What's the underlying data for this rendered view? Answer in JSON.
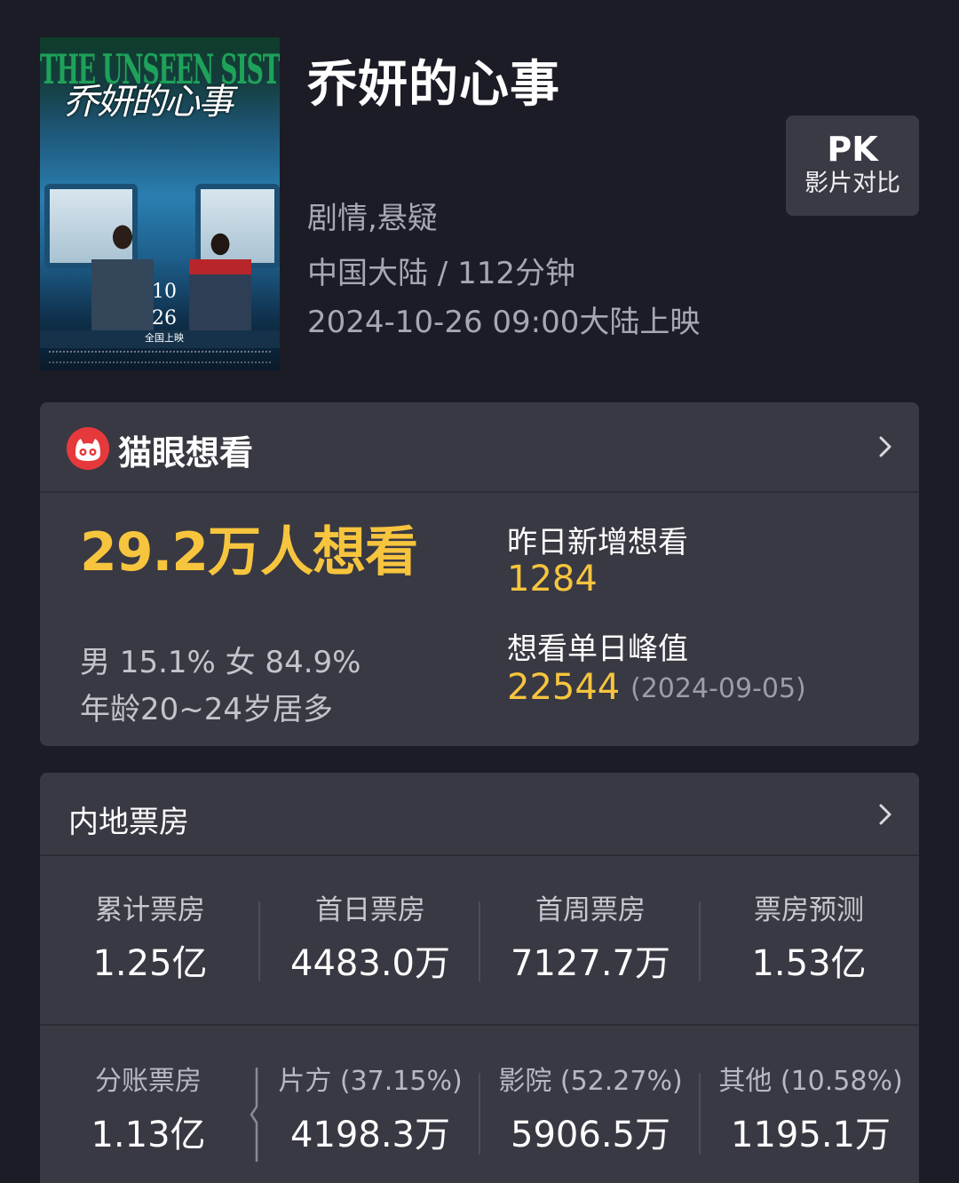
{
  "movie": {
    "poster_title_en": "THE UNSEEN SISTER",
    "poster_title_cn": "乔妍的心事",
    "poster_date_month": "10",
    "poster_date_day": "26",
    "poster_date_sub": "全国上映",
    "title": "乔妍的心事",
    "genre": "剧情,悬疑",
    "region_duration": "中国大陆 / 112分钟",
    "release": "2024-10-26 09:00大陆上映"
  },
  "pk_button": {
    "label": "PK",
    "sublabel": "影片对比"
  },
  "maoyan_card": {
    "title": "猫眼想看",
    "want_total": "29.2万人想看",
    "gender": "男 15.1% 女 84.9%",
    "age": "年龄20~24岁居多",
    "yesterday_label": "昨日新增想看",
    "yesterday_value": "1284",
    "peak_label": "想看单日峰值",
    "peak_value": "22544",
    "peak_date": "(2024-09-05)"
  },
  "box_office_card": {
    "title": "内地票房",
    "row1": [
      {
        "label": "累计票房",
        "value": "1.25亿"
      },
      {
        "label": "首日票房",
        "value": "4483.0万"
      },
      {
        "label": "首周票房",
        "value": "7127.7万"
      },
      {
        "label": "票房预测",
        "value": "1.53亿"
      }
    ],
    "row2": [
      {
        "label": "分账票房",
        "value": "1.13亿"
      },
      {
        "label": "片方 (37.15%)",
        "value": "4198.3万"
      },
      {
        "label": "影院 (52.27%)",
        "value": "5906.5万"
      },
      {
        "label": "其他 (10.58%)",
        "value": "1195.1万"
      }
    ]
  },
  "colors": {
    "background": "#1c1c26",
    "card": "#393943",
    "accent_yellow": "#f7c53d",
    "maoyan_red": "#e5393c"
  }
}
